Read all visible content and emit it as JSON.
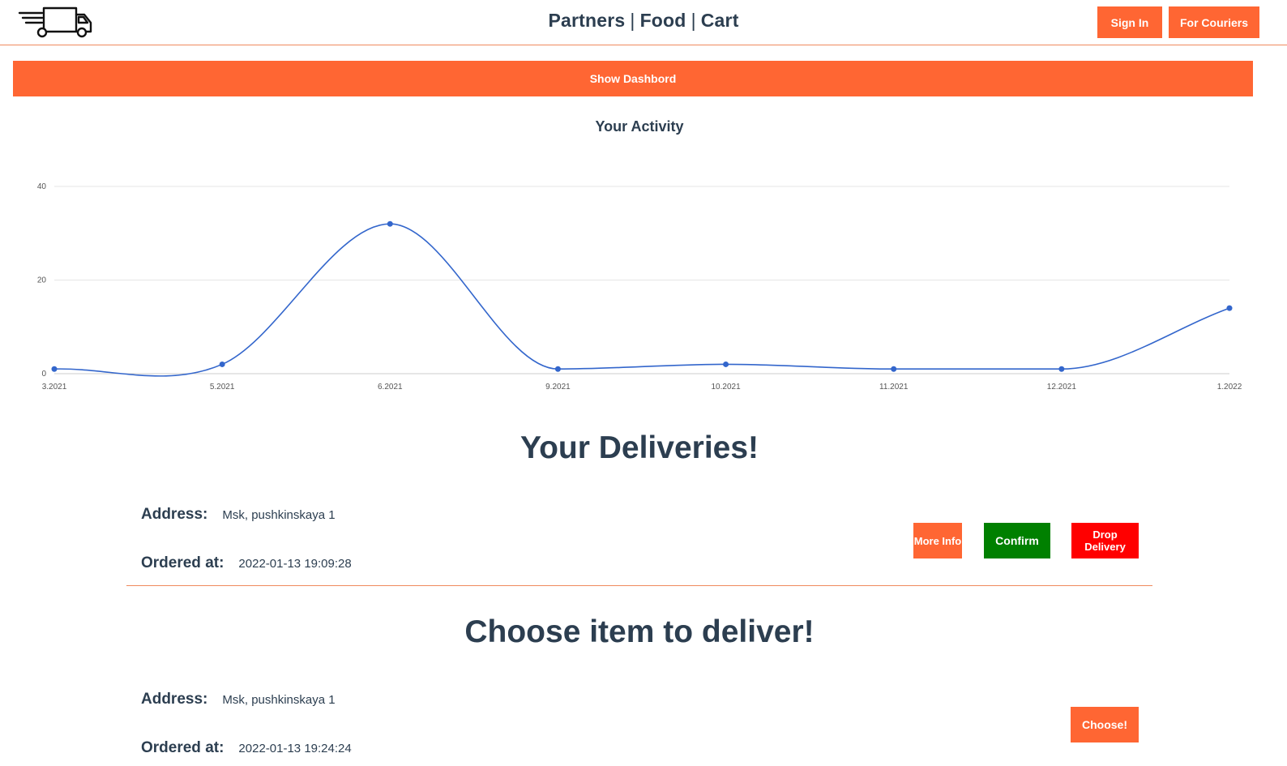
{
  "header": {
    "brand": {
      "part1": "Partners",
      "part2": "Food",
      "part3": "Cart",
      "separator": "|"
    },
    "logo_icon": "delivery-truck-icon",
    "sign_in_label": "Sign In",
    "for_couriers_label": "For Couriers"
  },
  "dashboard_button_label": "Show Dashbord",
  "chart_data": {
    "type": "line",
    "title": "Your Activity",
    "categories": [
      "3.2021",
      "5.2021",
      "6.2021",
      "9.2021",
      "10.2021",
      "11.2021",
      "12.2021",
      "1.2022"
    ],
    "values": [
      1,
      2,
      32,
      1,
      2,
      1,
      1,
      14
    ],
    "yticks": [
      0,
      20,
      40
    ],
    "ylim": [
      0,
      40
    ],
    "xlabel": "",
    "ylabel": "",
    "grid": true,
    "smooth": true,
    "color": "#3366cc"
  },
  "deliveries": {
    "title": "Your Deliveries!",
    "items": [
      {
        "address_label": "Address:",
        "address": "Msk, pushkinskaya 1",
        "ordered_label": "Ordered at:",
        "ordered_at": "2022-01-13 19:09:28",
        "more_info_label": "More Info",
        "confirm_label": "Confirm",
        "drop_label": "Drop Delivery"
      }
    ]
  },
  "available": {
    "title": "Choose item to deliver!",
    "items": [
      {
        "address_label": "Address:",
        "address": "Msk, pushkinskaya 1",
        "ordered_label": "Ordered at:",
        "ordered_at": "2022-01-13 19:24:24",
        "choose_label": "Choose!"
      }
    ]
  },
  "colors": {
    "accent": "#ff6633",
    "confirm": "#008000",
    "drop": "#ff0000",
    "text": "#2c3e50",
    "chart_line": "#3366cc"
  }
}
